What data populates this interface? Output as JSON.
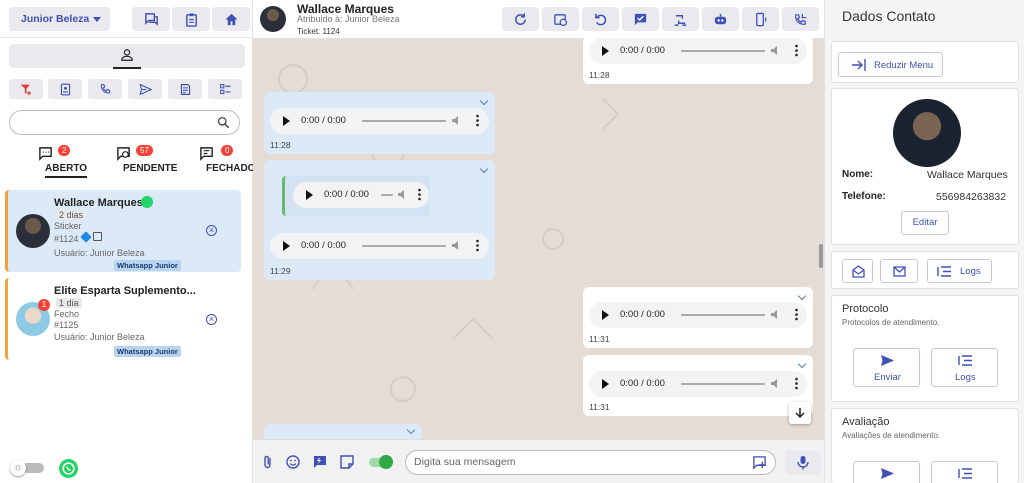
{
  "left": {
    "user_select": "Junior Beleza",
    "search": {
      "placeholder": ""
    },
    "tabs": [
      {
        "label": "ABERTO",
        "count": "2"
      },
      {
        "label": "PENDENTE",
        "count": "57"
      },
      {
        "label": "FECHADO",
        "count": "0"
      }
    ],
    "tickets": [
      {
        "name": "Wallace Marques",
        "age": "2 dias",
        "last_message": "Sticker",
        "id": "#1124",
        "user": "Usuário: Junior Beleza",
        "connection": "Whatsapp Junior"
      },
      {
        "name": "Elite Esparta Suplemento...",
        "age": "1 dia",
        "last_message": "Fecho",
        "id": "#1125",
        "user": "Usuário: Junior Beleza",
        "connection": "Whatsapp Junior",
        "unread": "1"
      }
    ],
    "toggle_icon": "☼"
  },
  "chat": {
    "contact_name": "Wallace Marques",
    "assigned": "Atribuido à: Junior Beleza",
    "ticket": "Ticket: 1124",
    "audio_time": "0:00 / 0:00",
    "messages": [
      {
        "direction": "out",
        "time": "11:28"
      },
      {
        "direction": "in",
        "time": "11:28"
      },
      {
        "direction": "in",
        "time": "11:29",
        "quoted": true
      },
      {
        "direction": "out",
        "time": "11:31"
      },
      {
        "direction": "out",
        "time": "11:31"
      }
    ],
    "input_placeholder": "Digita sua mensagem",
    "colors": {
      "accent": "#3f51b5",
      "incoming": "#dceaf8",
      "toggle_on": "#2eaa44"
    }
  },
  "right": {
    "title": "Dados Contato",
    "collapse_label": "Reduzir Menu",
    "name_label": "Nome:",
    "name_value": "Wallace Marques",
    "phone_label": "Telefone:",
    "phone_value": "556984263832",
    "edit_label": "Editar",
    "logs_label": "Logs",
    "protocol_title": "Protocolo",
    "protocol_sub": "Protocolos de atendimento.",
    "send_label": "Enviar",
    "rating_title": "Avaliação",
    "rating_sub": "Avaliações de atendimento."
  }
}
